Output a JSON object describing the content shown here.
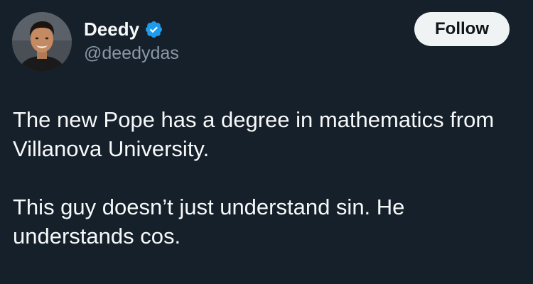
{
  "author": {
    "display_name": "Deedy",
    "handle": "@deedydas",
    "verified": true,
    "verified_color": "#1d9bf0"
  },
  "follow_button": {
    "label": "Follow"
  },
  "tweet": {
    "paragraphs": [
      "The new Pope has a degree in mathematics from Villanova University.",
      "This guy doesn’t just understand sin. He understands cos."
    ]
  },
  "colors": {
    "background": "#15202b",
    "text": "#f7f9f9",
    "secondary_text": "#8b98a5",
    "button_bg": "#eff3f4",
    "button_text": "#0f1419"
  }
}
